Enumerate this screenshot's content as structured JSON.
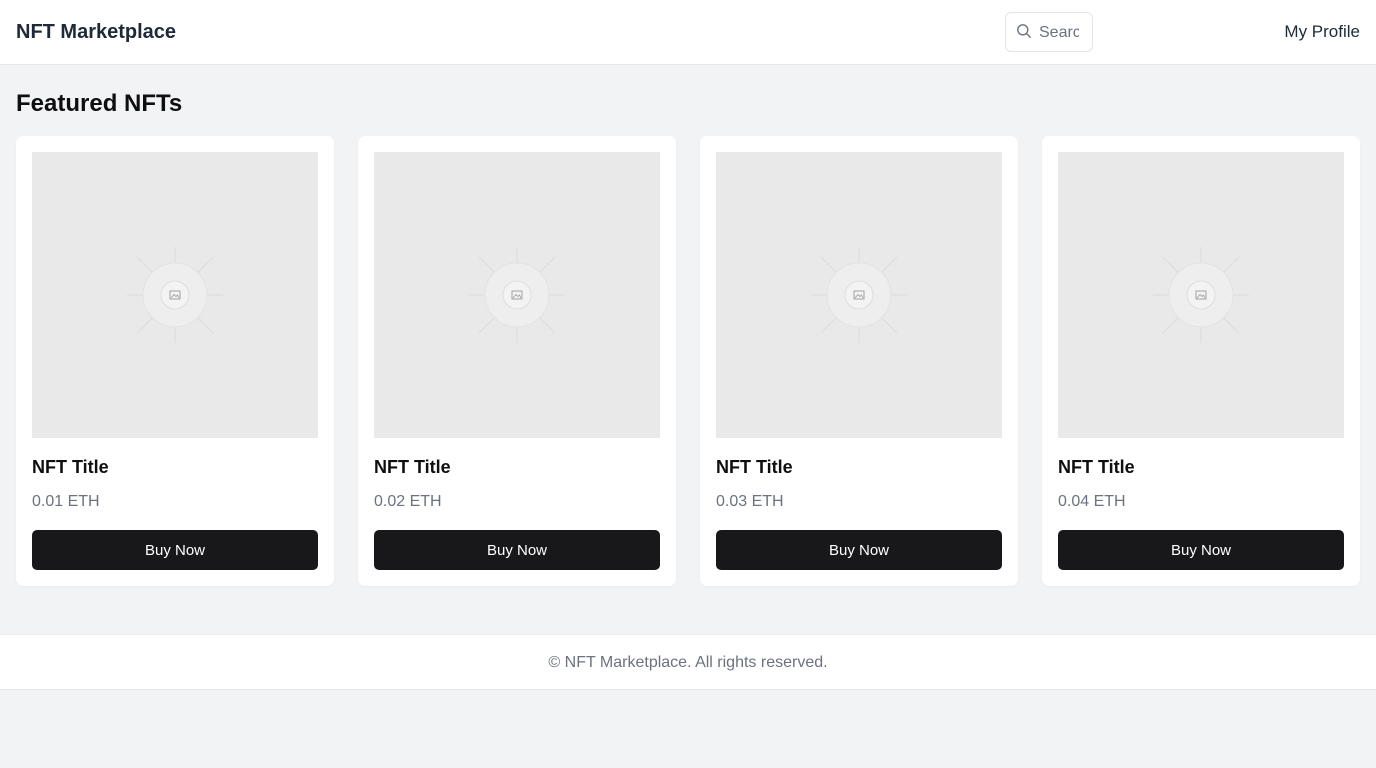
{
  "header": {
    "brand": "NFT Marketplace",
    "search_placeholder": "Search",
    "search_icon": "search-icon",
    "profile_label": "My Profile"
  },
  "main": {
    "section_title": "Featured NFTs",
    "cards": [
      {
        "title": "NFT Title",
        "price": "0.01 ETH",
        "button_label": "Buy Now",
        "image_icon": "image-placeholder-icon"
      },
      {
        "title": "NFT Title",
        "price": "0.02 ETH",
        "button_label": "Buy Now",
        "image_icon": "image-placeholder-icon"
      },
      {
        "title": "NFT Title",
        "price": "0.03 ETH",
        "button_label": "Buy Now",
        "image_icon": "image-placeholder-icon"
      },
      {
        "title": "NFT Title",
        "price": "0.04 ETH",
        "button_label": "Buy Now",
        "image_icon": "image-placeholder-icon"
      }
    ]
  },
  "footer": {
    "text": "© NFT Marketplace. All rights reserved."
  },
  "colors": {
    "page_background": "#f2f3f5",
    "surface": "#ffffff",
    "button_background": "#18181b",
    "button_text": "#ffffff",
    "muted_text": "#6b7280",
    "image_placeholder": "#e9e9e9"
  }
}
